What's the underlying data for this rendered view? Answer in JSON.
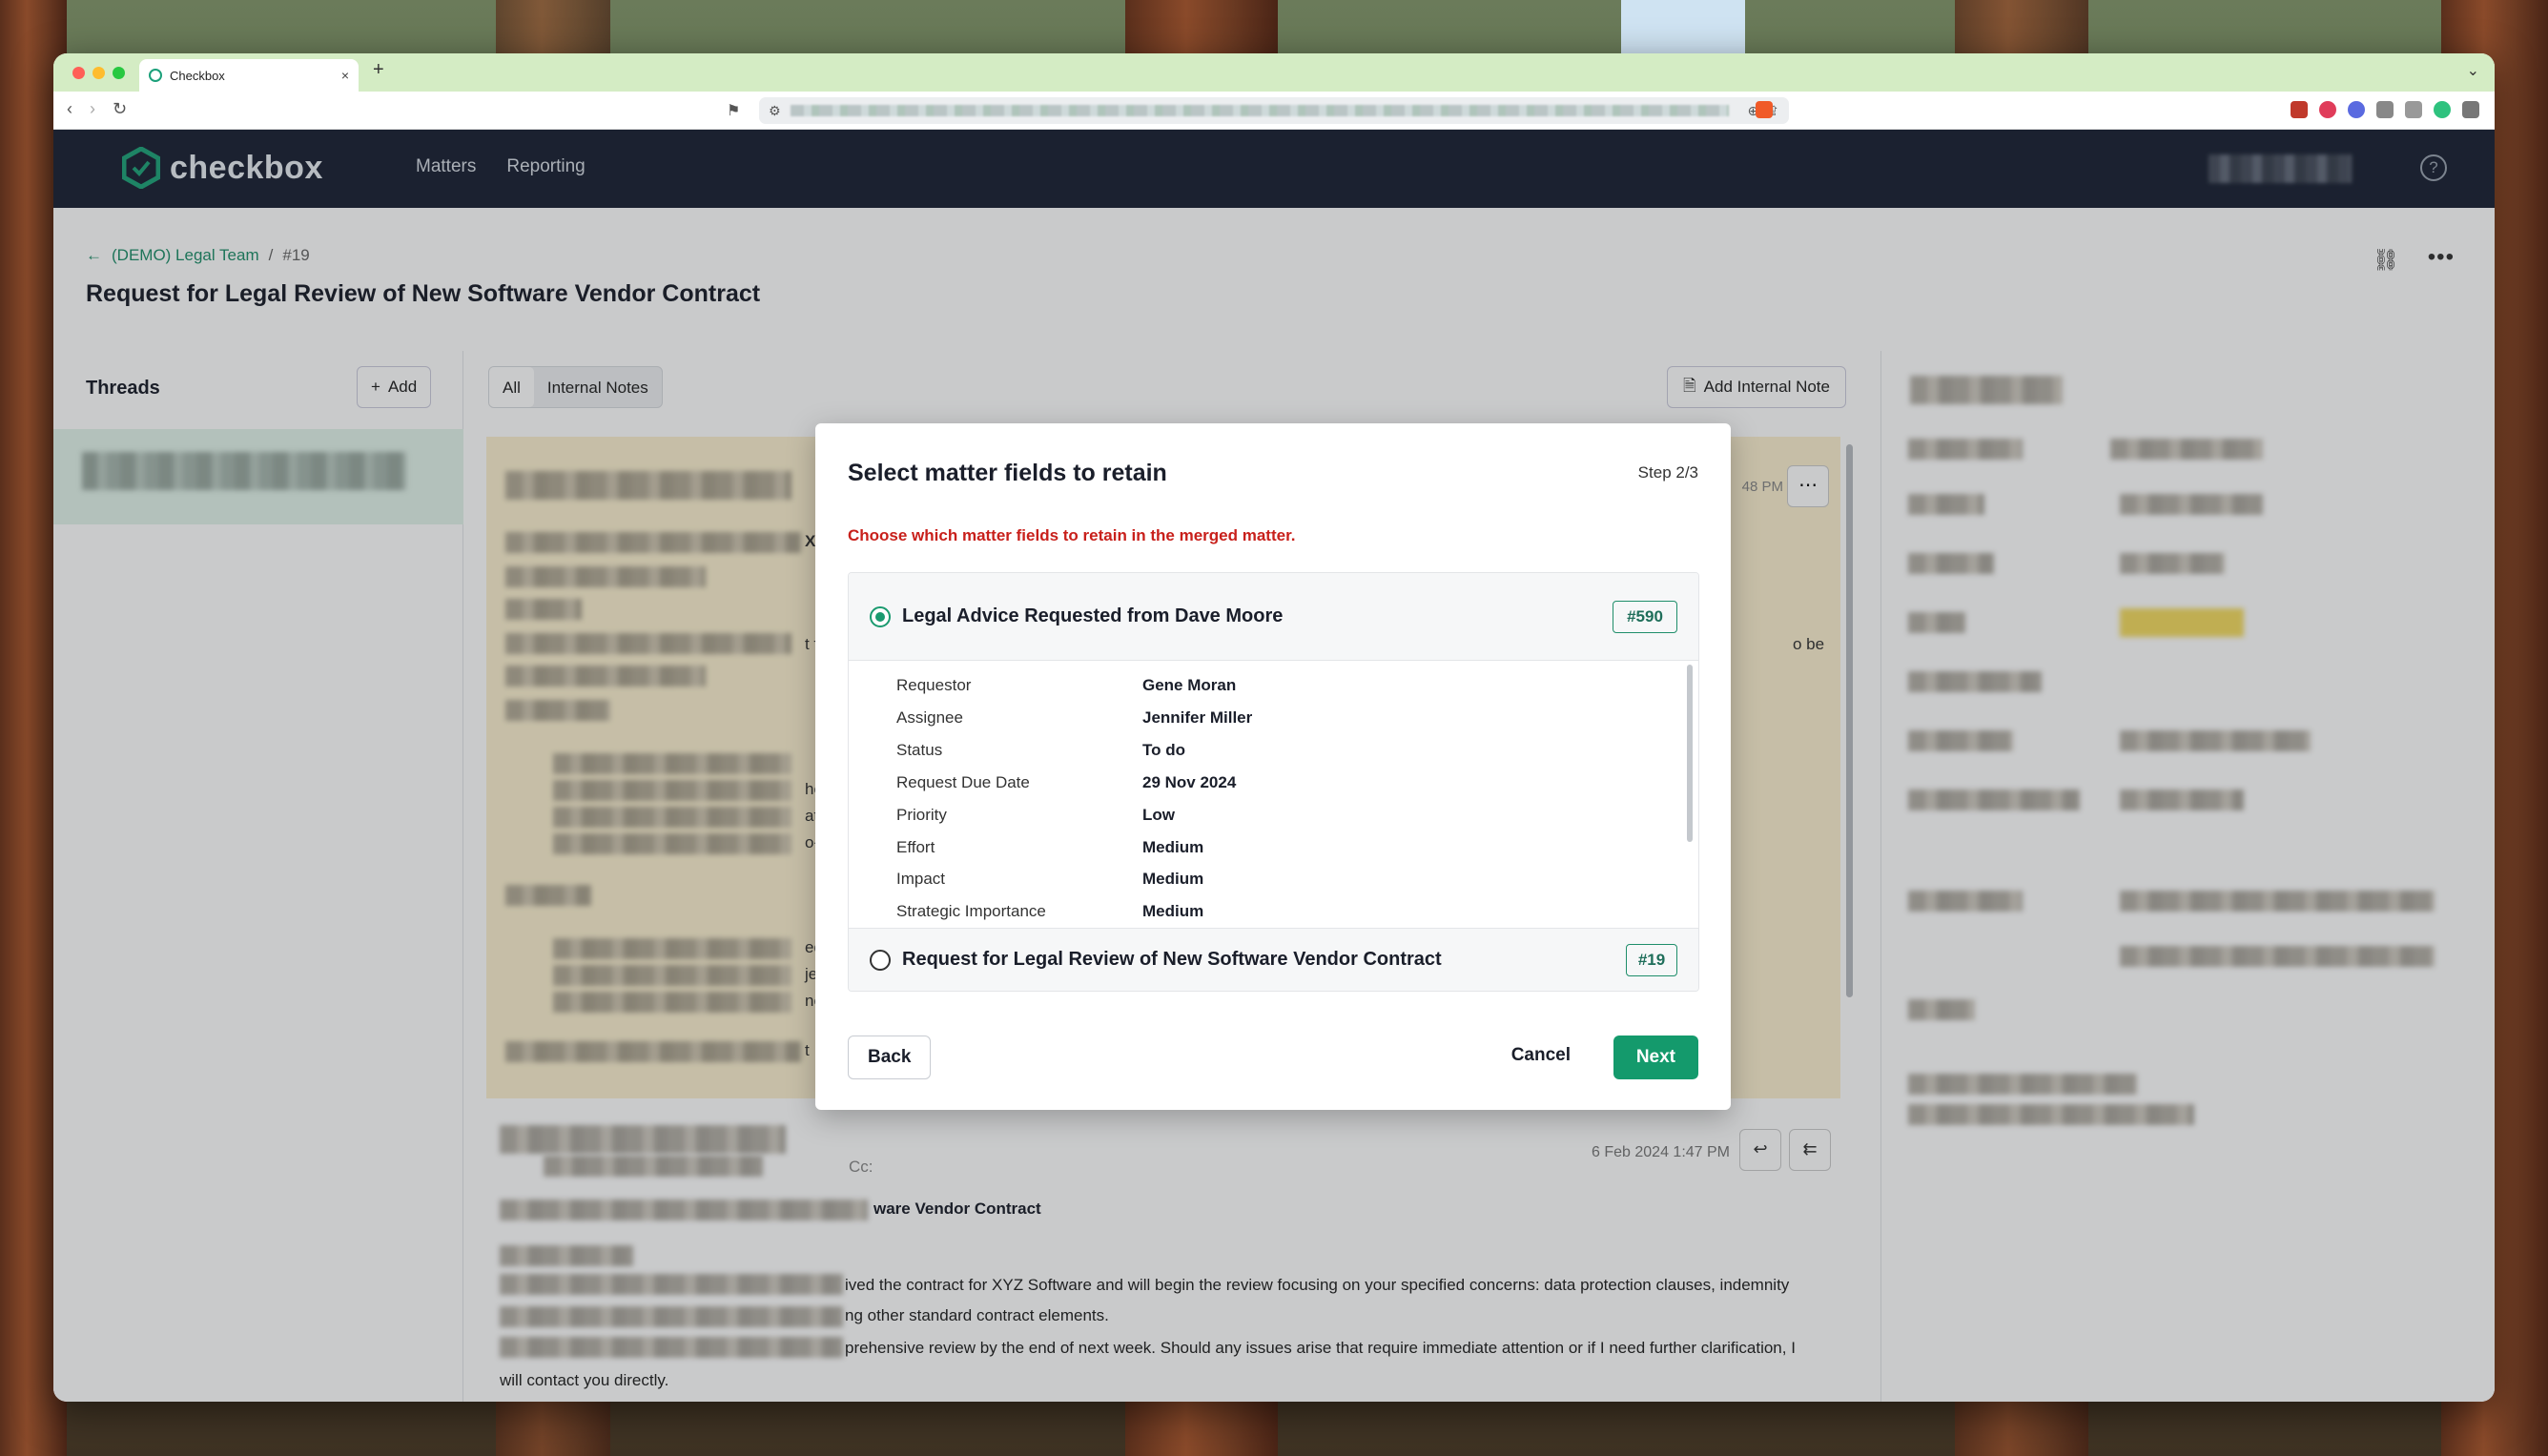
{
  "browser": {
    "tab_title": "Checkbox",
    "new_tab": "+",
    "tab_close": "×",
    "traffic_colors": [
      "#ff5f57",
      "#febc2e",
      "#28c840"
    ],
    "ext_badge": "383"
  },
  "app": {
    "logo_text": "checkbox",
    "nav": [
      "Matters",
      "Reporting"
    ],
    "help_glyph": "?"
  },
  "page": {
    "breadcrumb_team": "(DEMO) Legal Team",
    "breadcrumb_sep": "/",
    "breadcrumb_num": "#19",
    "title": "Request for Legal Review of New Software Vendor Contract"
  },
  "threads": {
    "title": "Threads",
    "add_label": "Add"
  },
  "filters": {
    "all": "All",
    "internal": "Internal Notes",
    "add_note": "Add Internal Note"
  },
  "message1": {
    "time_fragment": "48 PM",
    "frag_xy": "XY",
    "frag_tf": "t f",
    "frag_obe": "o be",
    "frag_he": "he",
    "frag_at": "at t",
    "frag_or": "o-r",
    "frag_ed": "ed",
    "frag_je": "je",
    "frag_ne": "ne",
    "frag_t": "t"
  },
  "message2": {
    "time": "6 Feb 2024 1:47 PM",
    "cc": "Cc:",
    "subject_fragment": "ware Vendor Contract",
    "line1": "ived the contract for XYZ Software and will begin the review focusing on your specified concerns: data protection clauses, indemnity",
    "line2": "ng other standard contract elements.",
    "line3": "prehensive review by the end of next week. Should any issues arise that require immediate attention or if I need further clarification, I",
    "line4": "will contact you directly."
  },
  "modal": {
    "title": "Select matter fields to retain",
    "step": "Step 2/3",
    "hint": "Choose which matter fields to retain in the merged matter.",
    "option1": {
      "label": "Legal Advice Requested from Dave Moore",
      "badge": "#590",
      "selected": true,
      "fields": [
        {
          "key": "Requestor",
          "value": "Gene Moran"
        },
        {
          "key": "Assignee",
          "value": "Jennifer Miller"
        },
        {
          "key": "Status",
          "value": "To do"
        },
        {
          "key": "Request Due Date",
          "value": "29 Nov 2024"
        },
        {
          "key": "Priority",
          "value": "Low"
        },
        {
          "key": "Effort",
          "value": "Medium"
        },
        {
          "key": "Impact",
          "value": "Medium"
        },
        {
          "key": "Strategic Importance",
          "value": "Medium"
        }
      ]
    },
    "option2": {
      "label": "Request for Legal Review of New Software Vendor Contract",
      "badge": "#19",
      "selected": false
    },
    "back": "Back",
    "cancel": "Cancel",
    "next": "Next"
  }
}
